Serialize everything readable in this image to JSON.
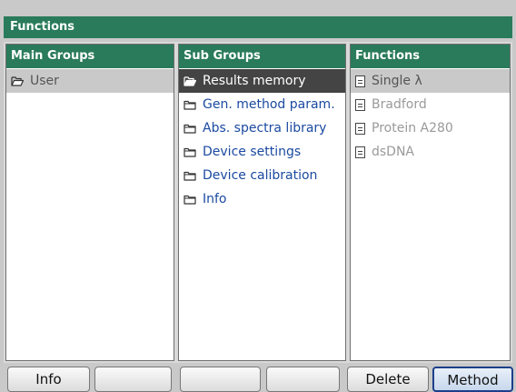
{
  "window": {
    "title": "Functions"
  },
  "panes": {
    "main_groups": {
      "header": "Main Groups",
      "items": [
        {
          "label": "User",
          "icon": "folder-open-icon"
        }
      ]
    },
    "sub_groups": {
      "header": "Sub Groups",
      "items": [
        {
          "label": "Results memory",
          "icon": "folder-open-icon",
          "selected": true
        },
        {
          "label": "Gen. method param.",
          "icon": "folder-icon"
        },
        {
          "label": "Abs. spectra library",
          "icon": "folder-icon"
        },
        {
          "label": "Device settings",
          "icon": "folder-icon"
        },
        {
          "label": "Device calibration",
          "icon": "folder-icon"
        },
        {
          "label": "Info",
          "icon": "folder-icon"
        }
      ]
    },
    "functions": {
      "header": "Functions",
      "items": [
        {
          "label": "Single λ",
          "icon": "document-icon",
          "highlighted": true
        },
        {
          "label": "Bradford",
          "icon": "document-icon"
        },
        {
          "label": "Protein A280",
          "icon": "document-icon"
        },
        {
          "label": "dsDNA",
          "icon": "document-icon"
        }
      ]
    }
  },
  "softkeys": [
    {
      "label": "Info"
    },
    {
      "label": ""
    },
    {
      "label": ""
    },
    {
      "label": ""
    },
    {
      "label": "Delete"
    },
    {
      "label": "Method",
      "active": true
    }
  ],
  "colors": {
    "header_green": "#2a7b5b",
    "selection_dark": "#444444",
    "link_blue": "#1b4aa0",
    "disabled_gray": "#9a9a9a",
    "active_softkey_border": "#1d3f8a"
  }
}
